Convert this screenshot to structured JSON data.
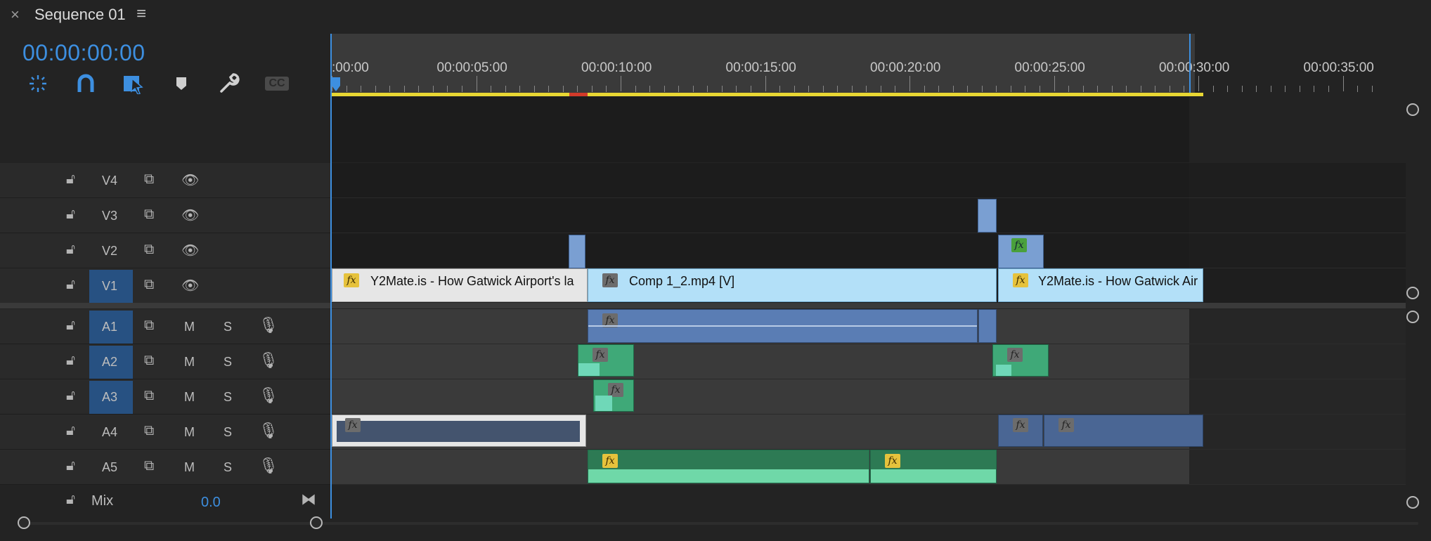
{
  "panel": {
    "close_glyph": "×",
    "title": "Sequence 01",
    "menu_glyph": "≡",
    "timecode": "00:00:00:00"
  },
  "tools": [
    {
      "name": "snap-nest-icon",
      "active": true
    },
    {
      "name": "snapping-magnet-icon",
      "active": true
    },
    {
      "name": "linked-selection-icon",
      "active": true
    },
    {
      "name": "add-marker-icon",
      "active": false
    },
    {
      "name": "timeline-settings-wrench-icon",
      "active": false
    },
    {
      "name": "captions-cc-icon",
      "active": false,
      "label": "CC"
    }
  ],
  "ruler": {
    "labels": [
      ":00:00",
      "00:00:05:00",
      "00:00:10:00",
      "00:00:15:00",
      "00:00:20:00",
      "00:00:25:00",
      "00:00:30:00",
      "00:00:35:00"
    ]
  },
  "video_tracks": [
    {
      "label": "V4",
      "targeted": false
    },
    {
      "label": "V3",
      "targeted": false
    },
    {
      "label": "V2",
      "targeted": false
    },
    {
      "label": "V1",
      "targeted": true
    }
  ],
  "audio_tracks": [
    {
      "label": "A1",
      "targeted": true,
      "mute": "M",
      "solo": "S"
    },
    {
      "label": "A2",
      "targeted": true,
      "mute": "M",
      "solo": "S"
    },
    {
      "label": "A3",
      "targeted": true,
      "mute": "M",
      "solo": "S"
    },
    {
      "label": "A4",
      "targeted": false,
      "mute": "M",
      "solo": "S"
    },
    {
      "label": "A5",
      "targeted": false,
      "mute": "M",
      "solo": "S"
    }
  ],
  "mix": {
    "label": "Mix",
    "value": "0.0"
  },
  "clips": {
    "v1_a": "Y2Mate.is - How Gatwick Airport's la",
    "v1_b": "Comp 1_2.mp4 [V]",
    "v1_c": "Y2Mate.is - How Gatwick Air",
    "fx": "fx"
  },
  "colors": {
    "accent": "#3d8fe0",
    "video_clip": "#b3e0f8",
    "video_clip_selected": "#e6e6e6",
    "audio_clip_blue": "#5a7db4",
    "audio_clip_green": "#3fa978",
    "audio_clip_teal": "#6fd8b8",
    "workarea": "#e8d733"
  }
}
